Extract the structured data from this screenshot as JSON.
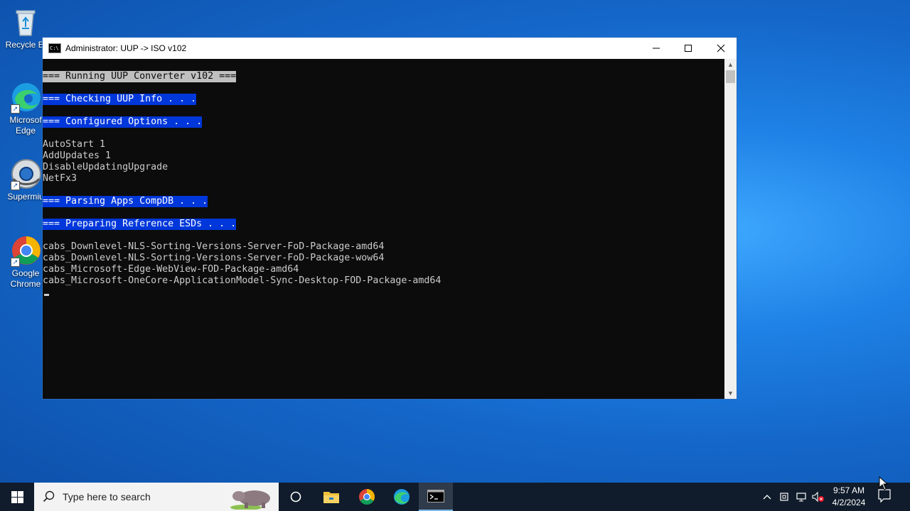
{
  "desktop": {
    "icons": [
      {
        "label": "Recycle Bi"
      },
      {
        "label1": "Microsof",
        "label2": "Edge"
      },
      {
        "label": "Supermiu"
      },
      {
        "label1": "Google",
        "label2": "Chrome"
      }
    ]
  },
  "window": {
    "title": "Administrator:  UUP -> ISO v102"
  },
  "console": {
    "lines": [
      "=== Running UUP Converter v102 ===",
      "=== Checking UUP Info . . .",
      "=== Configured Options . . .",
      "AutoStart 1",
      "AddUpdates 1",
      "DisableUpdatingUpgrade",
      "NetFx3",
      "=== Parsing Apps CompDB . . .",
      "=== Preparing Reference ESDs . . .",
      "cabs_Downlevel-NLS-Sorting-Versions-Server-FoD-Package-amd64",
      "cabs_Downlevel-NLS-Sorting-Versions-Server-FoD-Package-wow64",
      "cabs_Microsoft-Edge-WebView-FOD-Package-amd64",
      "cabs_Microsoft-OneCore-ApplicationModel-Sync-Desktop-FOD-Package-amd64"
    ]
  },
  "taskbar": {
    "search_placeholder": "Type here to search",
    "time": "9:57 AM",
    "date": "4/2/2024"
  },
  "colors": {
    "console_bg": "#0c0c0c",
    "console_fg": "#cccccc",
    "highlight_blue": "#0037da",
    "highlight_grey": "#c0c0c0",
    "taskbar_bg": "#101c2b"
  }
}
